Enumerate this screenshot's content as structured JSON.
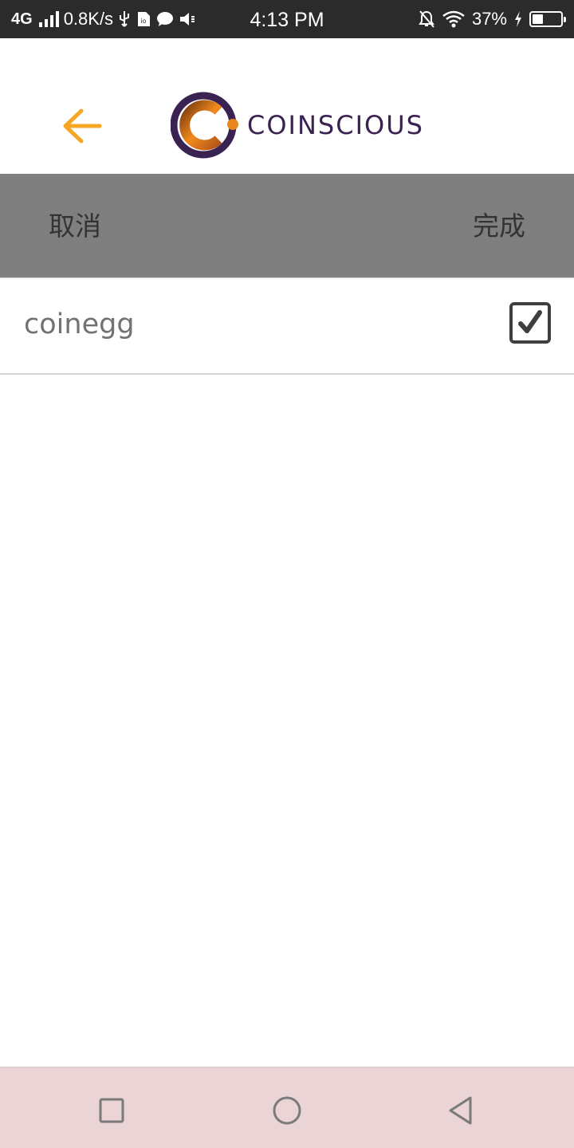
{
  "status_bar": {
    "network": "4G",
    "speed": "0.8K/s",
    "time": "4:13 PM",
    "battery": "37%",
    "battery_level": 0.37,
    "icons": [
      "signal-icon",
      "usb-icon",
      "sim-icon",
      "chat-icon",
      "volume-muted-icon",
      "notification-off-icon",
      "wifi-icon",
      "charging-icon",
      "battery-icon"
    ]
  },
  "header": {
    "brand": "COINSCIOUS",
    "back_icon": "arrow-left-icon",
    "accent_color": "#f5a623",
    "brand_color": "#3a2352"
  },
  "action_bar": {
    "cancel_label": "取消",
    "done_label": "完成"
  },
  "list": {
    "items": [
      {
        "label": "coinegg",
        "checked": true
      }
    ]
  },
  "nav_bar": {
    "icons": [
      "recent-apps-icon",
      "home-icon",
      "back-icon"
    ]
  }
}
